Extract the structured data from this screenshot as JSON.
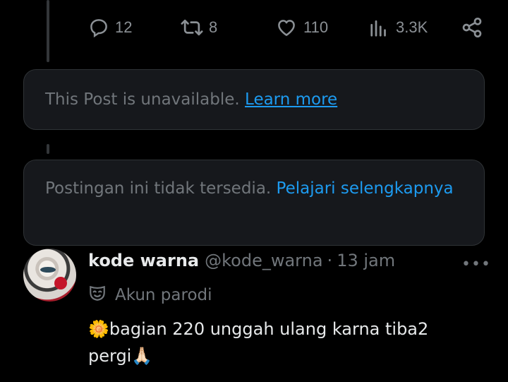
{
  "actions": {
    "reply": {
      "icon": "reply-icon",
      "count": "12"
    },
    "repost": {
      "icon": "repost-icon",
      "count": "8"
    },
    "like": {
      "icon": "heart-icon",
      "count": "110"
    },
    "views": {
      "icon": "views-icon",
      "count": "3.3K"
    },
    "share": {
      "icon": "share-icon"
    }
  },
  "notice1": {
    "text": "This Post is unavailable.",
    "link": "Learn more"
  },
  "notice2": {
    "text": "Postingan ini tidak tersedia.",
    "link": "Pelajari selengkapnya"
  },
  "post": {
    "display_name": "kode warna",
    "handle": "@kode_warna",
    "separator": "·",
    "time": "13 jam",
    "more": "•••",
    "parody_label": "Akun parodi",
    "text_prefix_emoji": "🌼",
    "text": "bagian 220 unggah ulang karna tiba2 pergi",
    "text_suffix_emoji": "🙏🏻"
  },
  "colors": {
    "background": "#000000",
    "link": "#1d9bf0",
    "muted": "#71767b",
    "card": "#16181c"
  }
}
